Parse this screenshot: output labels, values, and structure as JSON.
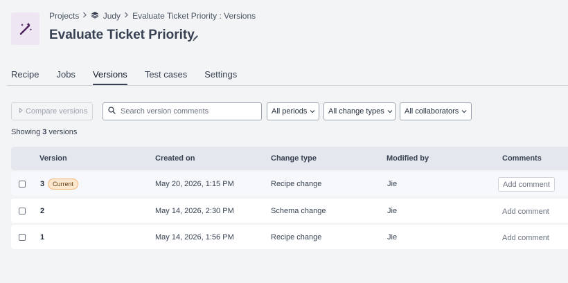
{
  "breadcrumb": {
    "projects": "Projects",
    "project": "Judy",
    "current": "Evaluate Ticket Priority : Versions"
  },
  "page": {
    "title": "Evaluate Ticket Priority"
  },
  "tabs": [
    {
      "label": "Recipe",
      "active": false
    },
    {
      "label": "Jobs",
      "active": false
    },
    {
      "label": "Versions",
      "active": true
    },
    {
      "label": "Test cases",
      "active": false
    },
    {
      "label": "Settings",
      "active": false
    }
  ],
  "toolbar": {
    "compare_label": "Compare versions",
    "search_placeholder": "Search version comments",
    "search_value": "",
    "period_filter": "All periods",
    "change_type_filter": "All change types",
    "collaborator_filter": "All collaborators"
  },
  "summary": {
    "prefix": "Showing",
    "count": "3",
    "suffix": "versions"
  },
  "table": {
    "headers": {
      "version": "Version",
      "created_on": "Created on",
      "change_type": "Change type",
      "modified_by": "Modified by",
      "comments": "Comments"
    },
    "rows": [
      {
        "version": "3",
        "badge": "Current",
        "created_on": "May 20, 2026, 1:15 PM",
        "change_type": "Recipe change",
        "modified_by": "Jie",
        "comment_action": "Add comment"
      },
      {
        "version": "2",
        "badge": "",
        "created_on": "May 14, 2026, 2:30 PM",
        "change_type": "Schema change",
        "modified_by": "Jie",
        "comment_action": "Add comment"
      },
      {
        "version": "1",
        "badge": "",
        "created_on": "May 14, 2026, 1:56 PM",
        "change_type": "Recipe change",
        "modified_by": "Jie",
        "comment_action": "Add comment"
      }
    ]
  },
  "colors": {
    "logo_bg": "#efe6f3",
    "logo_icon": "#4a1f5c",
    "badge_bg": "#fde7cd",
    "badge_border": "#f3b77a",
    "header_row_bg": "#e5e7ee"
  },
  "icons": {
    "logo": "magic-wand-icon",
    "breadcrumb_separator": "chevron-right-icon",
    "project": "stack-icon",
    "edit": "pencil-icon",
    "compare": "compare-icon",
    "search": "search-icon",
    "dropdown": "chevron-down-icon"
  }
}
